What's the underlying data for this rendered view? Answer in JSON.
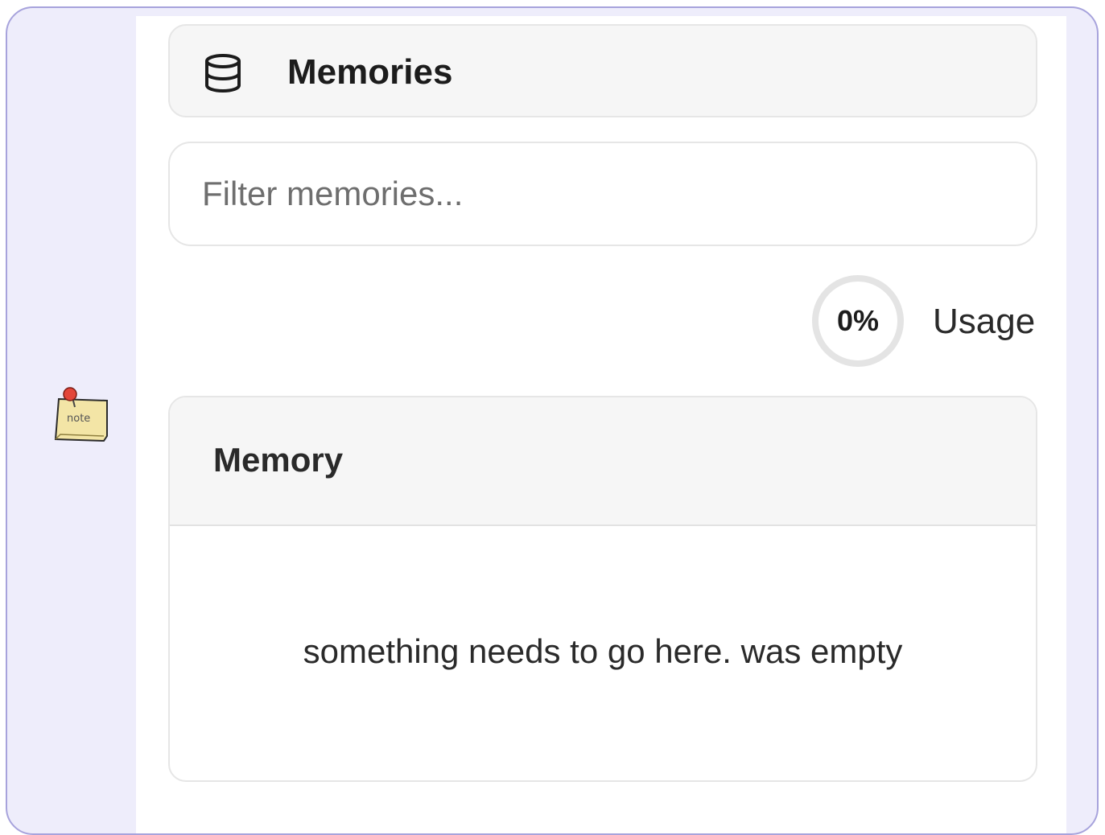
{
  "header": {
    "icon": "database-icon",
    "title": "Memories"
  },
  "filter": {
    "placeholder": "Filter memories..."
  },
  "usage": {
    "percent_text": "0%",
    "percent_value": 0,
    "label": "Usage"
  },
  "table": {
    "columns": [
      "Memory"
    ],
    "empty_message": "something needs to go here. was empty"
  },
  "side_icon": {
    "name": "note-icon",
    "text": "note"
  },
  "colors": {
    "frame_bg": "#eeedfb",
    "frame_border": "#a7a3dc",
    "card_bg": "#f6f6f6",
    "card_border": "#e6e6e6"
  }
}
